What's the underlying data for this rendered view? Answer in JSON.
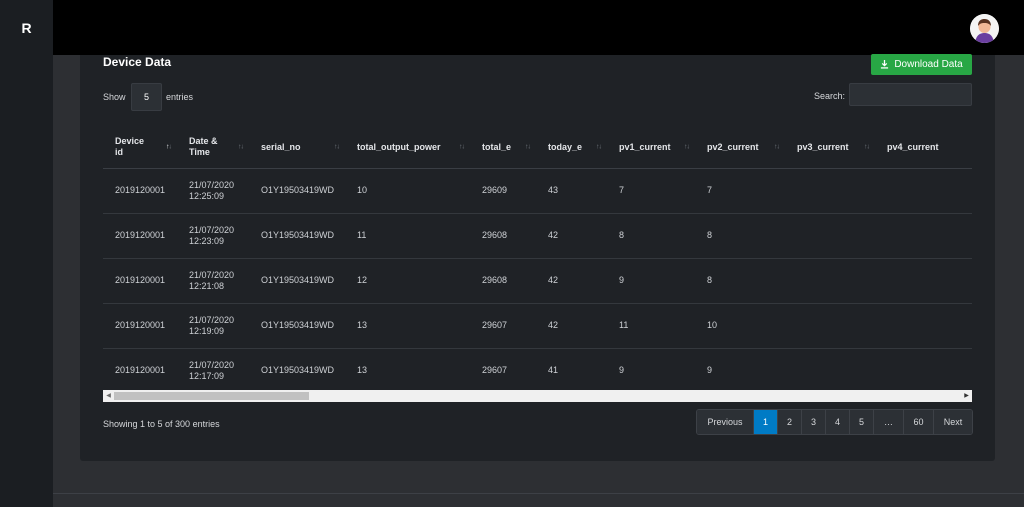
{
  "brand": {
    "letter": "R"
  },
  "card": {
    "title": "Device Data",
    "download_label": "Download Data"
  },
  "length": {
    "show": "Show",
    "value": "5",
    "suffix": "entries"
  },
  "search": {
    "label": "Search:",
    "value": ""
  },
  "table": {
    "columns": [
      "Device id",
      "Date & Time",
      "serial_no",
      "total_output_power",
      "total_e",
      "today_e",
      "pv1_current",
      "pv2_current",
      "pv3_current",
      "pv4_current"
    ],
    "rows": [
      [
        "2019120001",
        "21/07/2020 12:25:09",
        "O1Y19503419WD",
        "10",
        "29609",
        "43",
        "7",
        "7",
        "",
        ""
      ],
      [
        "2019120001",
        "21/07/2020 12:23:09",
        "O1Y19503419WD",
        "11",
        "29608",
        "42",
        "8",
        "8",
        "",
        ""
      ],
      [
        "2019120001",
        "21/07/2020 12:21:08",
        "O1Y19503419WD",
        "12",
        "29608",
        "42",
        "9",
        "8",
        "",
        ""
      ],
      [
        "2019120001",
        "21/07/2020 12:19:09",
        "O1Y19503419WD",
        "13",
        "29607",
        "42",
        "11",
        "10",
        "",
        ""
      ],
      [
        "2019120001",
        "21/07/2020 12:17:09",
        "O1Y19503419WD",
        "13",
        "29607",
        "41",
        "9",
        "9",
        "",
        ""
      ]
    ]
  },
  "info": "Showing 1 to 5 of 300 entries",
  "pagination": {
    "previous": "Previous",
    "pages": [
      "1",
      "2",
      "3",
      "4",
      "5",
      "…",
      "60"
    ],
    "active": "1",
    "next": "Next"
  },
  "colors": {
    "accent_green": "#28a745",
    "active_page": "#007bc5",
    "topbar": "#000000",
    "card": "#1f2226"
  },
  "icons": {
    "download": "download-icon",
    "avatar": "user-avatar"
  }
}
